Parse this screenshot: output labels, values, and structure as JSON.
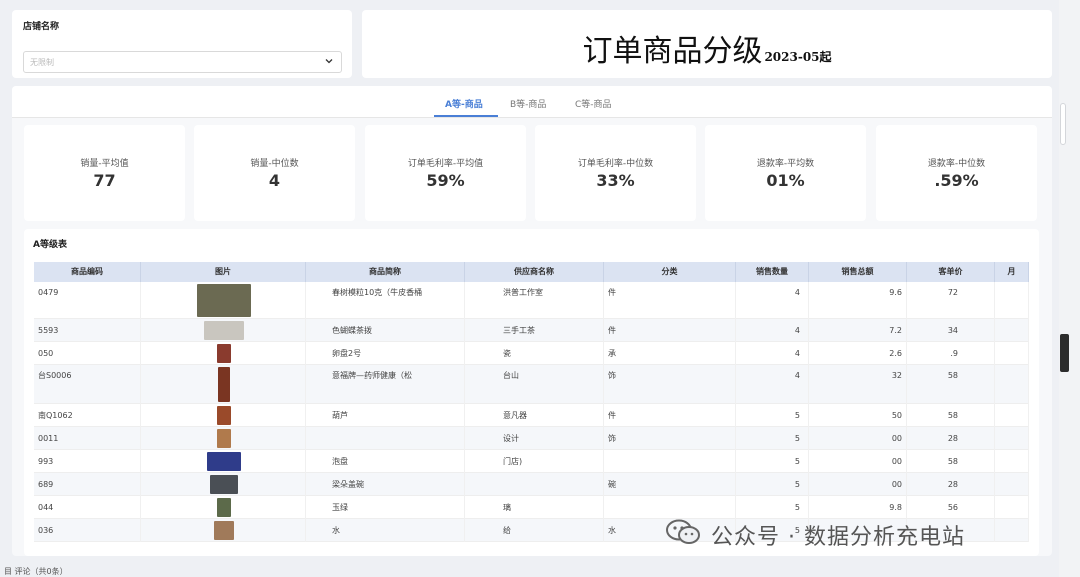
{
  "store": {
    "label": "店铺名称",
    "placeholder": "无限制"
  },
  "title": {
    "main": "订单商品分级",
    "sub": "2023-05起"
  },
  "tabs": [
    {
      "label": "A等-商品",
      "active": true
    },
    {
      "label": "B等-商品",
      "active": false
    },
    {
      "label": "C等-商品",
      "active": false
    }
  ],
  "kpis": [
    {
      "label": "销量-平均值",
      "value": "77"
    },
    {
      "label": "销量-中位数",
      "value": "4"
    },
    {
      "label": "订单毛利率-平均值",
      "value": "59%"
    },
    {
      "label": "订单毛利率-中位数",
      "value": "33%"
    },
    {
      "label": "退款率-平均数",
      "value": "01%"
    },
    {
      "label": "退款率-中位数",
      "value": ".59%"
    }
  ],
  "table": {
    "title": "A等级表",
    "columns": [
      "商品编码",
      "图片",
      "商品简称",
      "供应商名称",
      "分类",
      "销售数量",
      "销售总额",
      "客单价",
      "月"
    ],
    "rows": [
      {
        "code": "0479",
        "name": "春树模粒10克（牛皮香桶",
        "supplier": "洪普工作室",
        "category": "件",
        "qty": "4",
        "total": "9.6",
        "price": "72"
      },
      {
        "code": "5593",
        "name": "色蝴蝶茶拨",
        "supplier": "三手工茶",
        "category": "件",
        "qty": "4",
        "total": "7.2",
        "price": "34"
      },
      {
        "code": "050",
        "name": "卵盘2号",
        "supplier": "瓷",
        "category": "承",
        "qty": "4",
        "total": "2.6",
        "price": ".9"
      },
      {
        "code": "台S0006",
        "name": "意福牌—药师健康（松",
        "supplier": "台山",
        "category": "饰",
        "qty": "4",
        "total": "32",
        "price": "58"
      },
      {
        "code": "南Q1062",
        "name": "葫芦",
        "supplier": "意凡器",
        "category": "件",
        "qty": "5",
        "total": "50",
        "price": "58"
      },
      {
        "code": "0011",
        "name": "",
        "supplier": "设计",
        "category": "饰",
        "qty": "5",
        "total": "00",
        "price": "28"
      },
      {
        "code": "993",
        "name": "泡盘",
        "supplier": "门店)",
        "category": "",
        "qty": "5",
        "total": "00",
        "price": "58"
      },
      {
        "code": "689",
        "name": "梁朵盖碗",
        "supplier": "",
        "category": "碗",
        "qty": "5",
        "total": "00",
        "price": "28"
      },
      {
        "code": "044",
        "name": "玉绿",
        "supplier": "璃",
        "category": "",
        "qty": "5",
        "total": "9.8",
        "price": "56"
      },
      {
        "code": "036",
        "name": "水",
        "supplier": "给",
        "category": "水",
        "qty": "5",
        "total": "",
        "price": ""
      }
    ]
  },
  "watermark": {
    "text": "公众号 · 数据分析充电站"
  },
  "footer": {
    "text": "目 评论（共0条）"
  },
  "colors": {
    "accent": "#4a7fd6",
    "header_bg": "#dbe3f2",
    "page_bg": "#eef0f4"
  },
  "icons": {
    "select": "chevron-down-icon",
    "watermark": "wechat-icon"
  }
}
